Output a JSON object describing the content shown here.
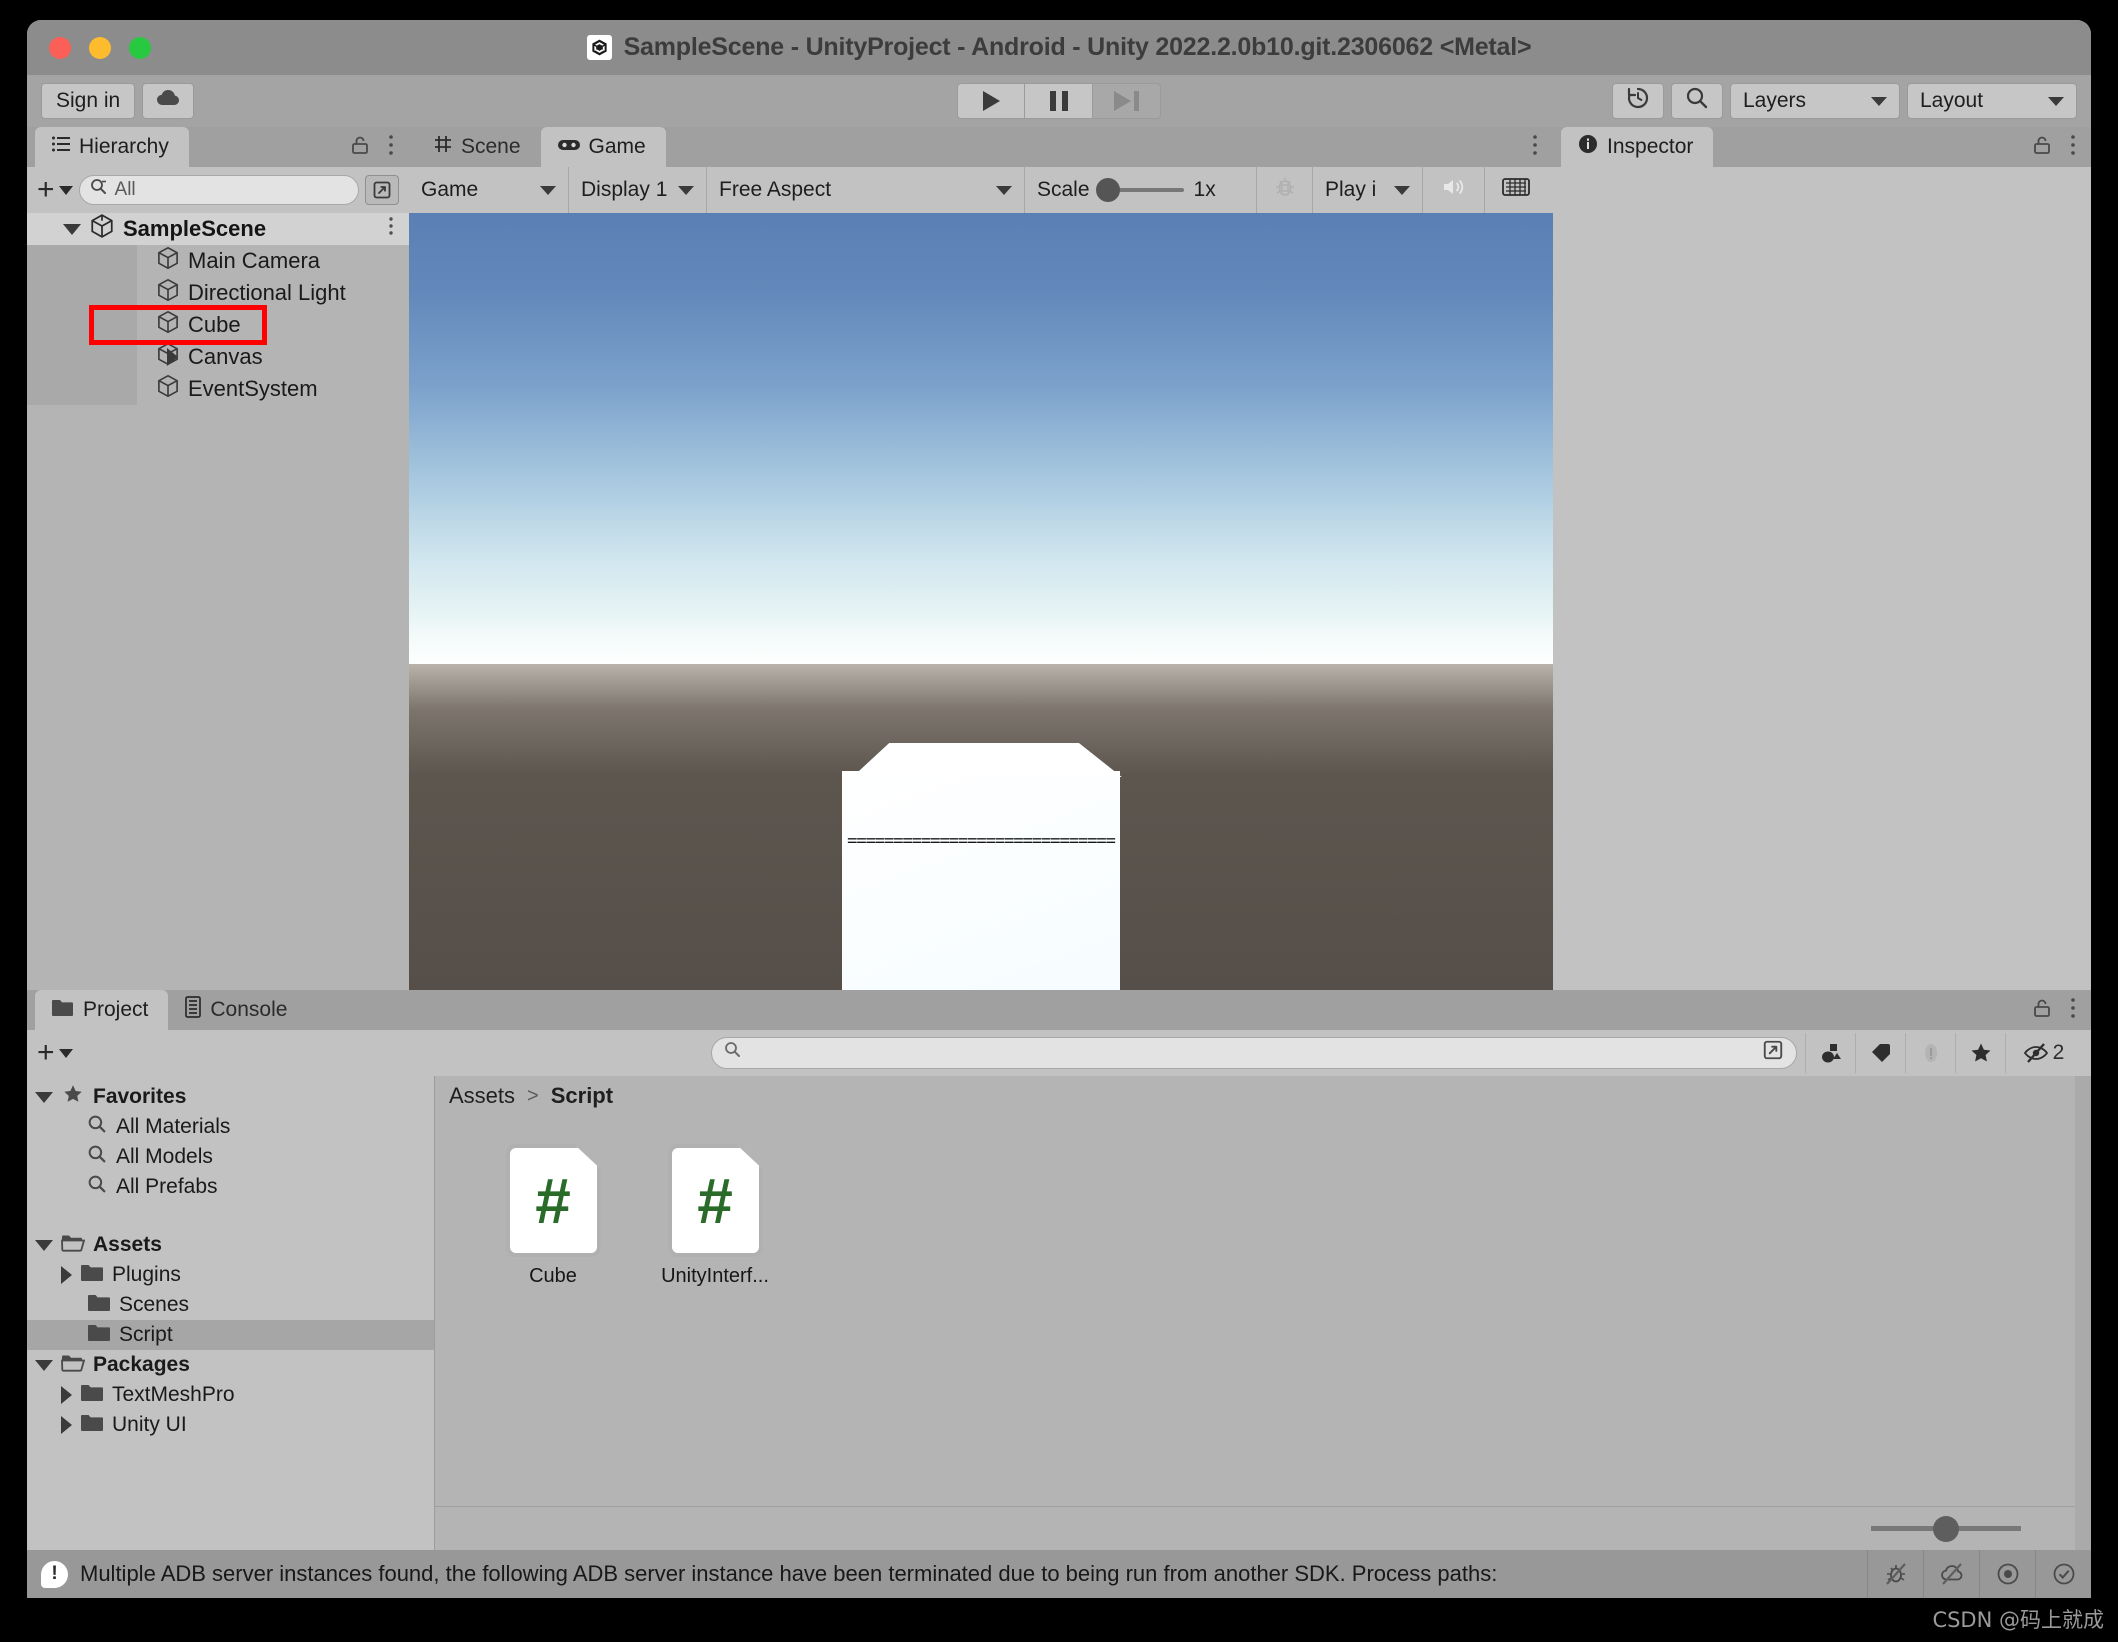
{
  "window": {
    "title": "SampleScene - UnityProject - Android - Unity 2022.2.0b10.git.2306062 <Metal>",
    "logo_name": "unity-logo"
  },
  "toolbar": {
    "sign_in_label": "Sign in",
    "cloud_icon": "cloud-icon",
    "play_icon": "play-icon",
    "pause_icon": "pause-icon",
    "step_icon": "step-forward-icon",
    "history_icon": "history-icon",
    "search_icon": "search-icon",
    "layers_label": "Layers",
    "layout_label": "Layout"
  },
  "hierarchy": {
    "tab_label": "Hierarchy",
    "add_label": "+",
    "search_value": "All",
    "scene_name": "SampleScene",
    "items": [
      {
        "label": "Main Camera",
        "has_arrow": false,
        "highlighted": false
      },
      {
        "label": "Directional Light",
        "has_arrow": false,
        "highlighted": false
      },
      {
        "label": "Cube",
        "has_arrow": false,
        "highlighted": true
      },
      {
        "label": "Canvas",
        "has_arrow": true,
        "highlighted": false
      },
      {
        "label": "EventSystem",
        "has_arrow": false,
        "highlighted": false
      }
    ]
  },
  "center": {
    "tab_scene": "Scene",
    "tab_game": "Game",
    "gameview_toolbar": {
      "mode": "Game",
      "display": "Display 1",
      "aspect": "Free Aspect",
      "scale_label": "Scale",
      "scale_value": "1x",
      "bug_icon": "bug-icon",
      "play_focus": "Play i",
      "mute_icon": "audio-icon",
      "stats_icon": "stats-icon"
    },
    "cube_face_text": "============================="
  },
  "inspector": {
    "tab_label": "Inspector",
    "info_icon": "info-icon"
  },
  "project": {
    "tab_project": "Project",
    "tab_console": "Console",
    "search_placeholder": "",
    "filter_icons": [
      "asset-type-filter-icon",
      "label-filter-icon",
      "warning-filter-icon",
      "favorite-star-icon"
    ],
    "hidden_count": "2",
    "breadcrumb": {
      "root": "Assets",
      "separator": ">",
      "current": "Script"
    },
    "tree": [
      {
        "label": "Favorites",
        "kind": "header",
        "icon": "star-icon",
        "indent": 0,
        "arrow": "down",
        "selected": false
      },
      {
        "label": "All Materials",
        "kind": "search",
        "icon": "search-icon",
        "indent": 1,
        "arrow": "none",
        "selected": false
      },
      {
        "label": "All Models",
        "kind": "search",
        "icon": "search-icon",
        "indent": 1,
        "arrow": "none",
        "selected": false
      },
      {
        "label": "All Prefabs",
        "kind": "search",
        "icon": "search-icon",
        "indent": 1,
        "arrow": "none",
        "selected": false
      },
      {
        "label": "Assets",
        "kind": "header",
        "icon": "open-folder-icon",
        "indent": 0,
        "arrow": "down",
        "selected": false
      },
      {
        "label": "Plugins",
        "kind": "folder",
        "icon": "folder-icon",
        "indent": 1,
        "arrow": "right",
        "selected": false
      },
      {
        "label": "Scenes",
        "kind": "folder",
        "icon": "folder-icon",
        "indent": 1,
        "arrow": "none",
        "selected": false
      },
      {
        "label": "Script",
        "kind": "folder",
        "icon": "folder-icon",
        "indent": 1,
        "arrow": "none",
        "selected": true
      },
      {
        "label": "Packages",
        "kind": "header",
        "icon": "open-folder-icon",
        "indent": 0,
        "arrow": "down",
        "selected": false
      },
      {
        "label": "TextMeshPro",
        "kind": "folder",
        "icon": "folder-icon",
        "indent": 1,
        "arrow": "right",
        "selected": false
      },
      {
        "label": "Unity UI",
        "kind": "folder",
        "icon": "folder-icon",
        "indent": 1,
        "arrow": "right",
        "selected": false
      }
    ],
    "assets": [
      {
        "label": "Cube",
        "icon": "csharp-script-icon",
        "glyph": "#"
      },
      {
        "label": "UnityInterf...",
        "icon": "csharp-script-icon",
        "glyph": "#"
      }
    ]
  },
  "status": {
    "message": "Multiple ADB server instances found, the following ADB server instance have been terminated due to being run from another SDK. Process paths:",
    "warning_icon": "warning-icon",
    "icons": [
      "no-bug-icon",
      "no-collab-icon",
      "target-icon",
      "check-circle-icon"
    ]
  },
  "watermark": "CSDN @码上就成",
  "colors": {
    "chrome": "#c2c2c2",
    "toolbar": "#a4a4a4",
    "titlebar": "#8c8c8c",
    "highlight_red": "#ff0000",
    "selection": "#a6a6a6",
    "script_green": "#2a6b2a"
  }
}
